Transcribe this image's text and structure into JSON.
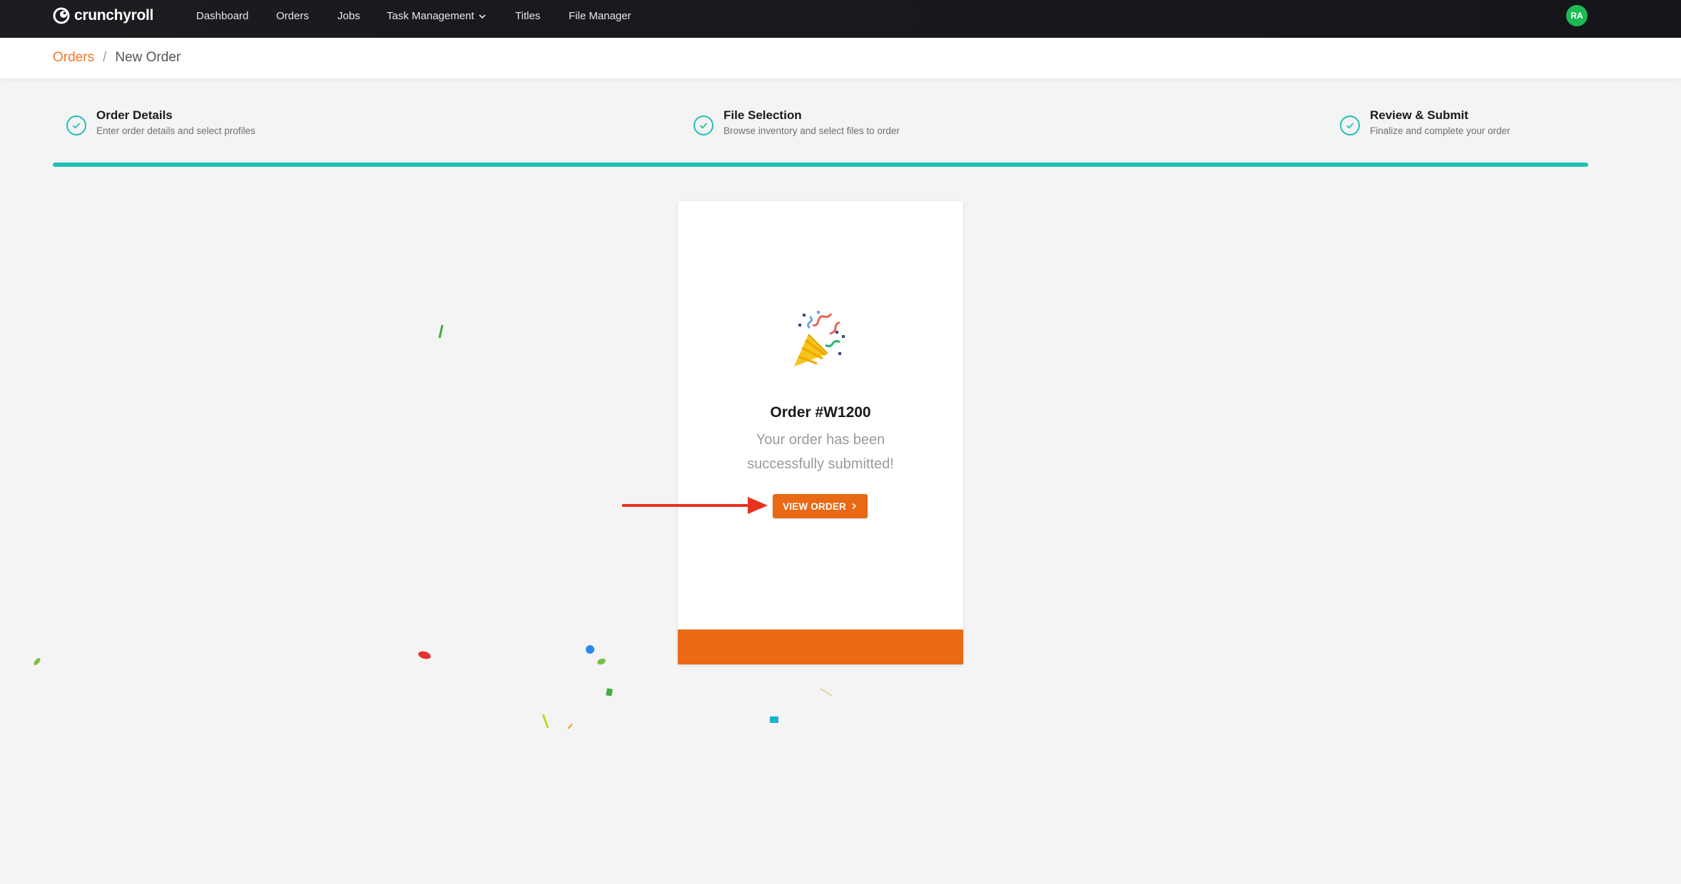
{
  "brand": {
    "name": "crunchyroll"
  },
  "nav": {
    "items": [
      {
        "label": "Dashboard"
      },
      {
        "label": "Orders"
      },
      {
        "label": "Jobs"
      },
      {
        "label": "Task Management"
      },
      {
        "label": "Titles"
      },
      {
        "label": "File Manager"
      }
    ],
    "avatar_initials": "RA"
  },
  "breadcrumb": {
    "link": "Orders",
    "separator": "/",
    "current": "New Order"
  },
  "steps": [
    {
      "title": "Order Details",
      "subtitle": "Enter order details and select profiles",
      "status": "complete"
    },
    {
      "title": "File Selection",
      "subtitle": "Browse inventory and select files to order",
      "status": "complete"
    },
    {
      "title": "Review & Submit",
      "subtitle": "Finalize and complete your order",
      "status": "complete"
    }
  ],
  "progress_fraction": 1.0,
  "card": {
    "icon": "party-popper-icon",
    "order_title": "Order #W1200",
    "message": "Your order has been successfully submitted!",
    "button_label": "VIEW ORDER"
  },
  "colors": {
    "brand_orange": "#e96914",
    "link_orange": "#f47521",
    "accent_teal": "#22c0b3",
    "avatar_green": "#1db954",
    "annotation_red": "#e8321f"
  }
}
